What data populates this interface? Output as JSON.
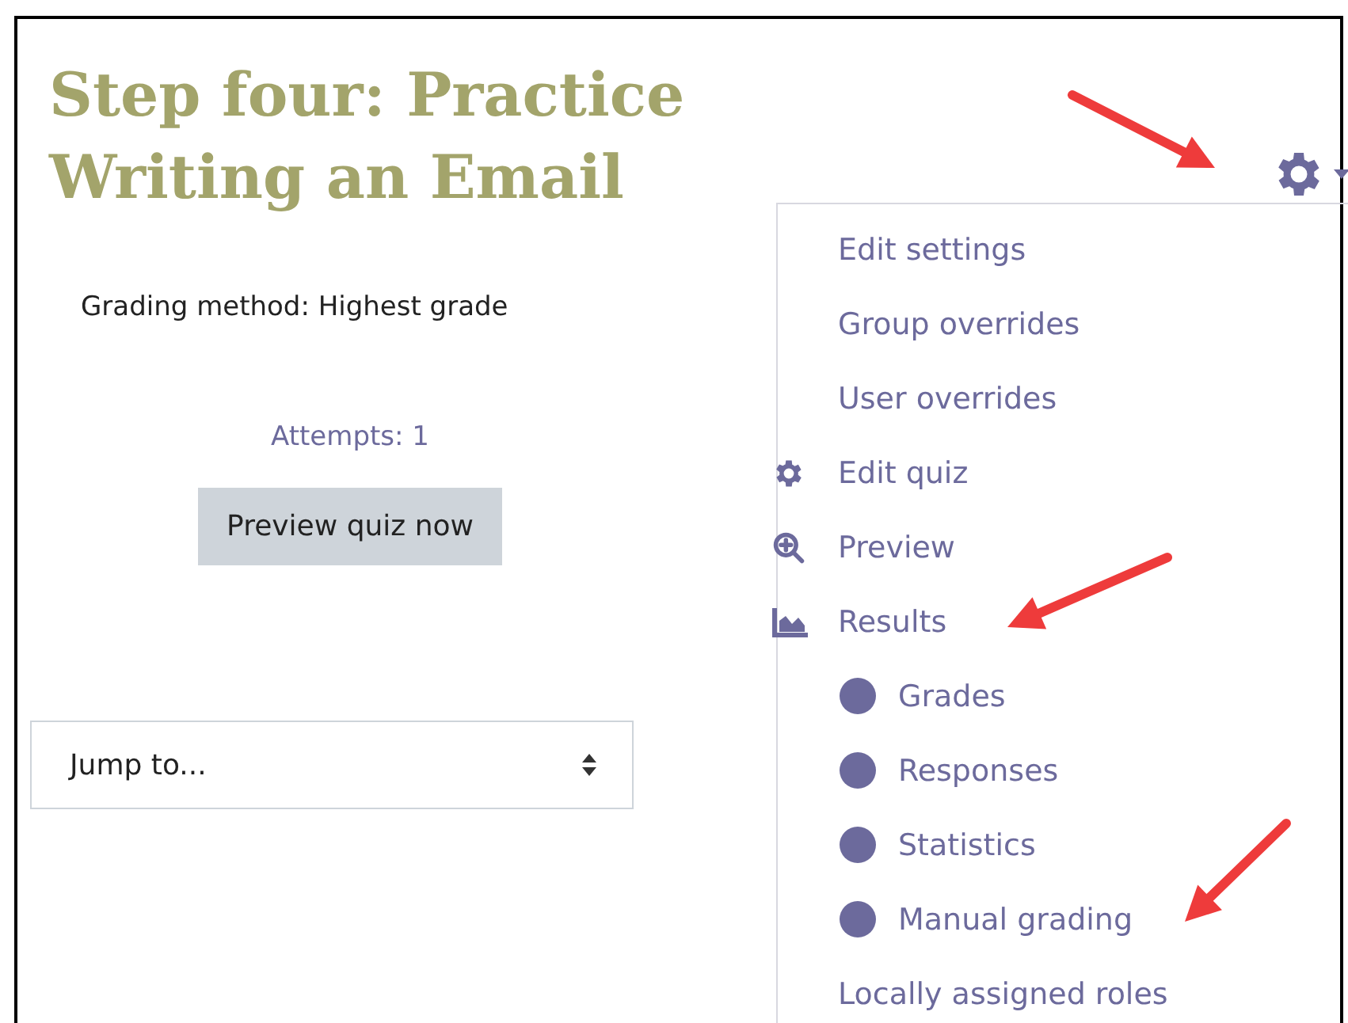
{
  "title": "Step four: Practice Writing an Email",
  "grading_method": "Grading method: Highest grade",
  "attempts": "Attempts: 1",
  "preview_button": "Preview quiz now",
  "jump_select": {
    "value": "Jump to..."
  },
  "settings_menu": {
    "expanded": true,
    "items": [
      {
        "kind": "link",
        "label": "Edit settings"
      },
      {
        "kind": "link",
        "label": "Group overrides"
      },
      {
        "kind": "link",
        "label": "User overrides"
      },
      {
        "kind": "tool",
        "label": "Edit quiz"
      },
      {
        "kind": "search",
        "label": "Preview"
      },
      {
        "kind": "report",
        "label": "Results"
      },
      {
        "kind": "subitem",
        "label": "Grades"
      },
      {
        "kind": "subitem",
        "label": "Responses"
      },
      {
        "kind": "subitem",
        "label": "Statistics"
      },
      {
        "kind": "subitem",
        "label": "Manual grading"
      },
      {
        "kind": "link",
        "label": "Locally assigned roles"
      }
    ]
  }
}
